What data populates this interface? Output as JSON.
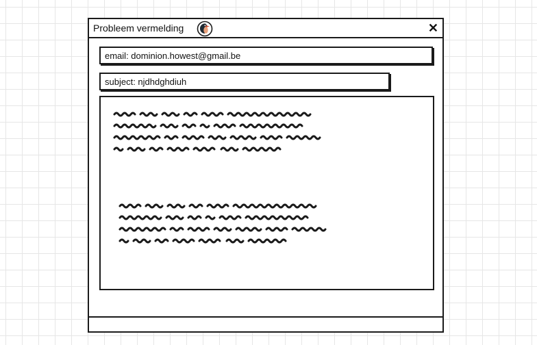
{
  "window": {
    "title": "Probleem vermelding",
    "app_icon": "penguin-icon",
    "close_glyph": "✕",
    "close_icon": "close-icon"
  },
  "form": {
    "email_text": "email: dominion.howest@gmail.be",
    "subject_text": "subject: njdhdghdiuh"
  },
  "message": {
    "paragraph_count": 2,
    "lines_per_paragraph": 4,
    "content": "scribbled placeholder text"
  },
  "colors": {
    "ink": "#1a1a1a",
    "grid": "#e6e6e6",
    "background": "#ffffff"
  }
}
